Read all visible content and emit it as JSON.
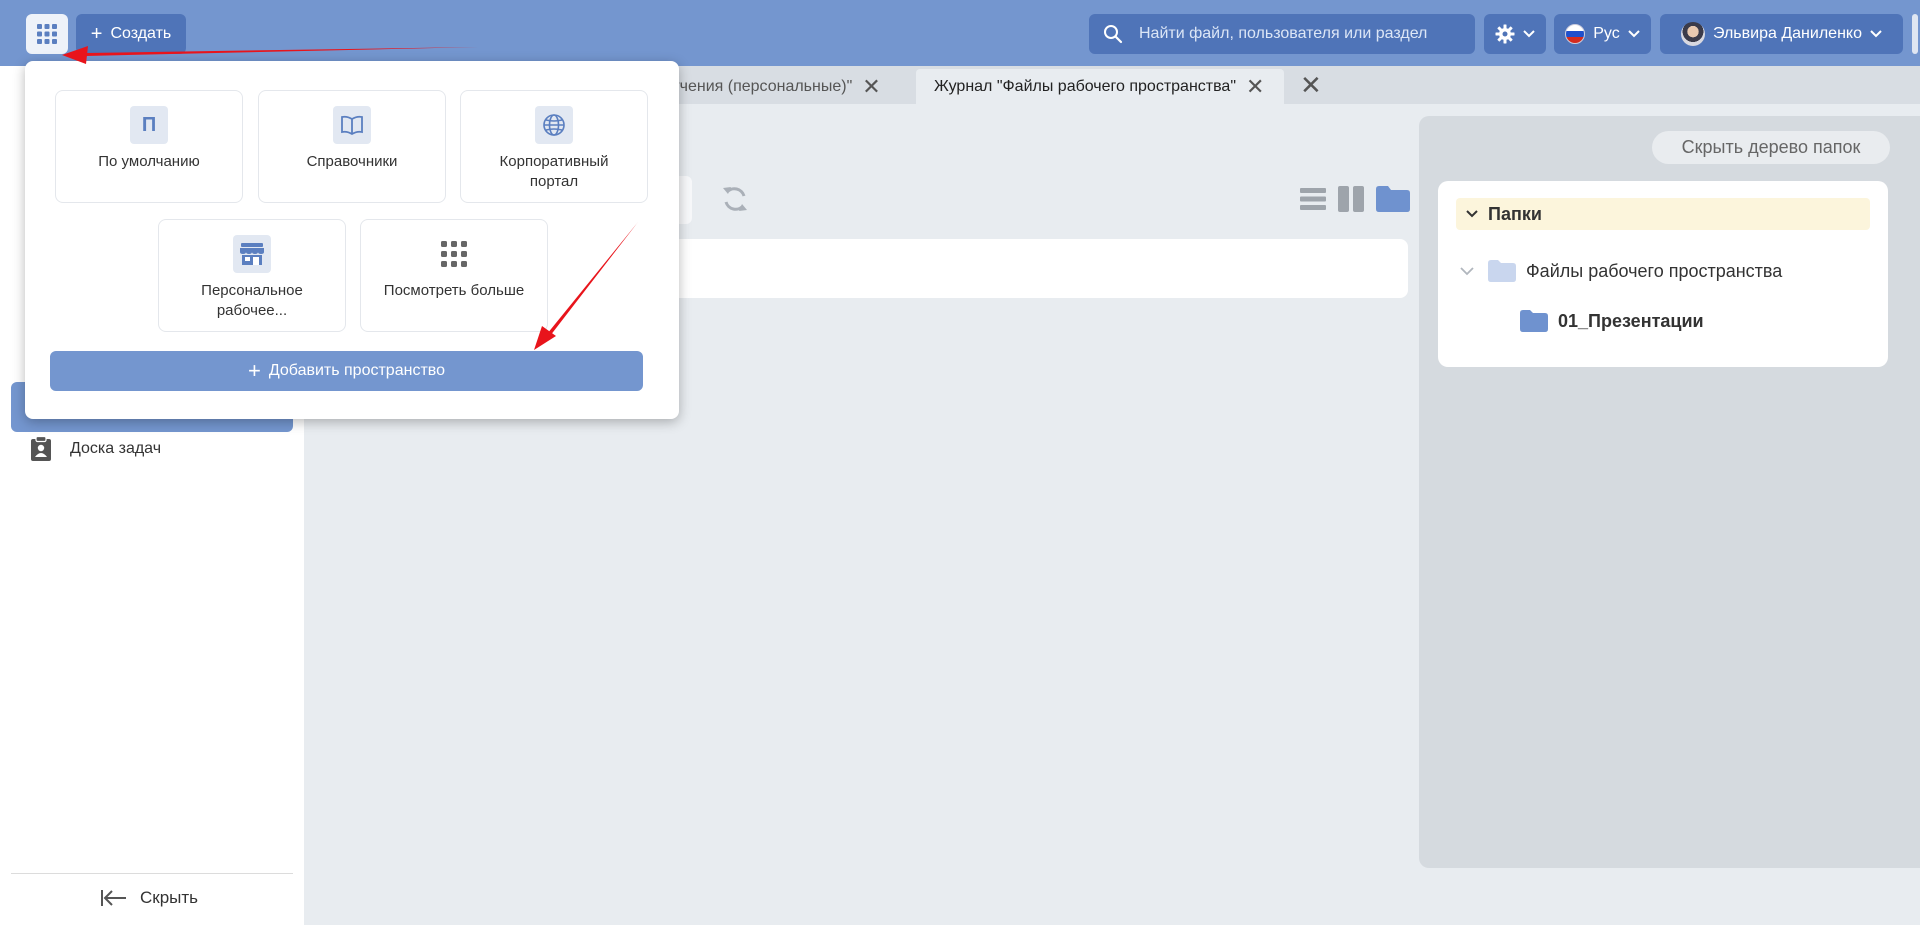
{
  "header": {
    "create_label": "Создать",
    "search_placeholder": "Найти файл, пользователя или раздел",
    "language_label": "Рус",
    "user_name": "Эльвира Даниленко"
  },
  "tabs": [
    {
      "label": "оручения (персональные)\""
    },
    {
      "label": "Журнал \"Файлы рабочего пространства\""
    }
  ],
  "sidebar": {
    "items": [
      {
        "label": "Доска задач"
      }
    ],
    "hide_label": "Скрыть"
  },
  "folder_tree": {
    "hide_button_label": "Скрыть дерево папок",
    "section_title": "Папки",
    "nodes": [
      {
        "label": "Файлы рабочего пространства"
      },
      {
        "label": "01_Презентации"
      }
    ]
  },
  "workspace_menu": {
    "cards": [
      {
        "label": "По умолчанию",
        "icon": "letter-p-icon",
        "icon_text": "П"
      },
      {
        "label": "Справочники",
        "icon": "book-icon"
      },
      {
        "label": "Корпоративный портал",
        "icon": "globe-icon"
      },
      {
        "label": "Персональное рабочее...",
        "icon": "store-icon"
      },
      {
        "label": "Посмотреть больше",
        "icon": "grid-icon"
      }
    ],
    "add_space_label": "Добавить пространство"
  },
  "colors": {
    "header": "#7496cf",
    "accent_dark": "#4f74b8",
    "annotation_arrow": "#e8141b"
  }
}
